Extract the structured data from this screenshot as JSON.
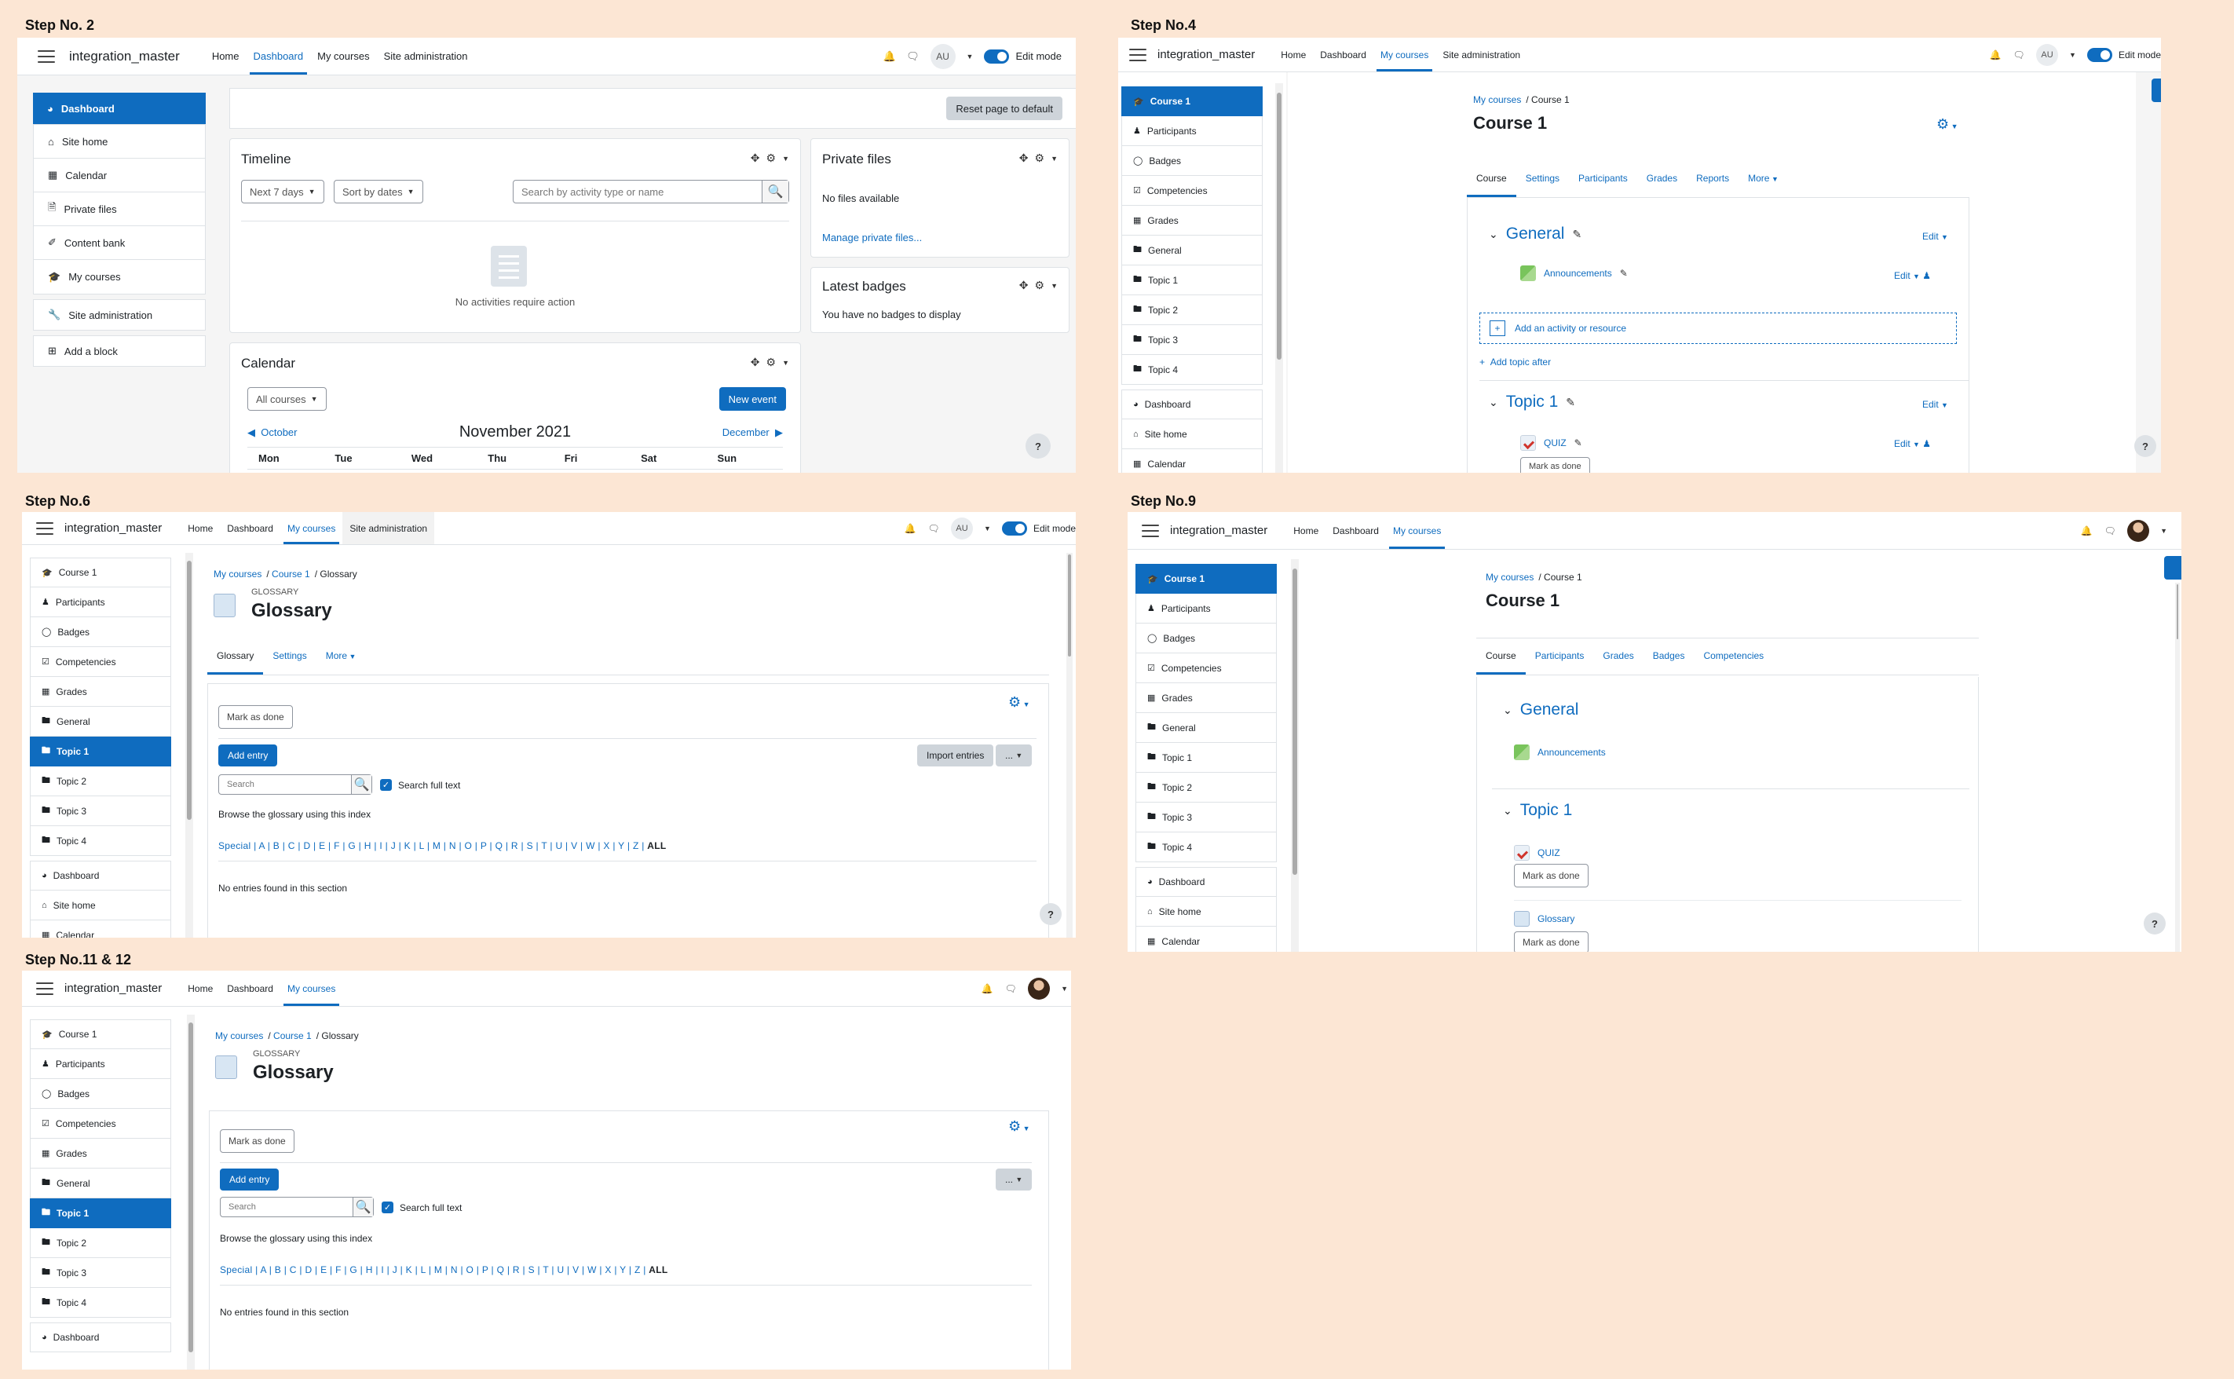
{
  "steps": {
    "s2": "Step No. 2",
    "s4": "Step No.4",
    "s6": "Step No.6",
    "s9": "Step No.9",
    "s1112": "Step No.11 & 12"
  },
  "common": {
    "brand": "integration_master",
    "nav": {
      "home": "Home",
      "dashboard": "Dashboard",
      "mycourses": "My courses",
      "siteadmin": "Site administration"
    },
    "avatar": "AU",
    "edit_mode": "Edit mode",
    "help": "?"
  },
  "p2": {
    "sidebar": [
      "Dashboard",
      "Site home",
      "Calendar",
      "Private files",
      "Content bank",
      "My courses",
      "Site administration",
      "Add a block"
    ],
    "reset": "Reset page to default",
    "timeline": {
      "title": "Timeline",
      "next": "Next 7 days",
      "sort": "Sort by dates",
      "search_ph": "Search by activity type or name",
      "empty": "No activities require action"
    },
    "private": {
      "title": "Private files",
      "empty": "No files available",
      "manage": "Manage private files..."
    },
    "badges": {
      "title": "Latest badges",
      "empty": "You have no badges to display"
    },
    "calendar": {
      "title": "Calendar",
      "all": "All courses",
      "new": "New event",
      "prev": "October",
      "month": "November 2021",
      "next": "December",
      "days": [
        "Mon",
        "Tue",
        "Wed",
        "Thu",
        "Fri",
        "Sat",
        "Sun"
      ]
    }
  },
  "coursenav": [
    "Course 1",
    "Participants",
    "Badges",
    "Competencies",
    "Grades",
    "General",
    "Topic 1",
    "Topic 2",
    "Topic 3",
    "Topic 4",
    "Dashboard",
    "Site home",
    "Calendar"
  ],
  "p4": {
    "crumb1": "My courses",
    "crumb2": "Course 1",
    "title": "Course 1",
    "tabs": [
      "Course",
      "Settings",
      "Participants",
      "Grades",
      "Reports",
      "More"
    ],
    "general": "General",
    "edit": "Edit",
    "announcements": "Announcements",
    "add_activity": "Add an activity or resource",
    "add_topic": "Add topic after",
    "topic1": "Topic 1",
    "quiz": "QUIZ",
    "mark": "Mark as done"
  },
  "p6": {
    "crumb1": "My courses",
    "crumb2": "Course 1",
    "crumb3": "Glossary",
    "kicker": "GLOSSARY",
    "title": "Glossary",
    "tabs": [
      "Glossary",
      "Settings",
      "More"
    ],
    "mark": "Mark as done",
    "add_entry": "Add entry",
    "import": "Import entries",
    "more": "...",
    "search_ph": "Search",
    "fulltext": "Search full text",
    "browse": "Browse the glossary using this index",
    "alpha": "Special | A | B | C | D | E | F | G | H | I | J | K | L | M | N | O | P | Q | R | S | T | U | V | W | X | Y | Z |",
    "all": "ALL",
    "empty": "No entries found in this section"
  },
  "p9": {
    "crumb1": "My courses",
    "crumb2": "Course 1",
    "title": "Course 1",
    "tabs": [
      "Course",
      "Participants",
      "Grades",
      "Badges",
      "Competencies"
    ],
    "general": "General",
    "announcements": "Announcements",
    "topic1": "Topic 1",
    "quiz": "QUIZ",
    "mark": "Mark as done",
    "glossary": "Glossary"
  }
}
